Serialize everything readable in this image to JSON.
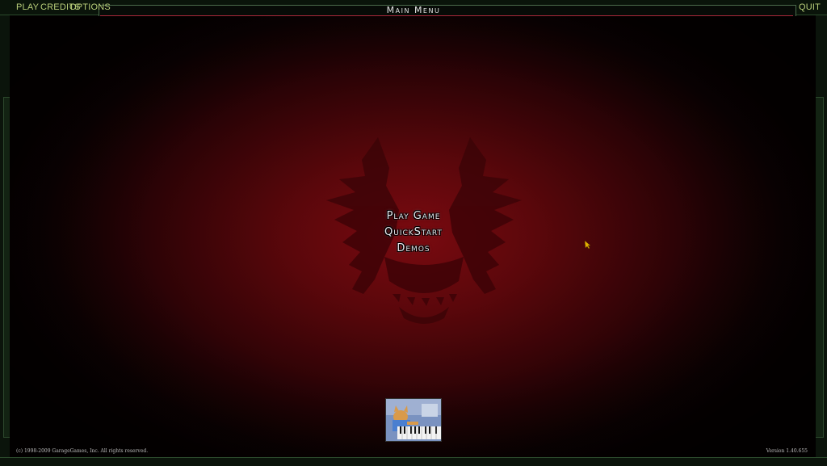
{
  "topbar": {
    "play_label": "PLAY",
    "credits_label": "CREDITS",
    "options_label": "OPTIONS",
    "quit_label": "QUIT",
    "title": "Main Menu"
  },
  "menu": {
    "items": [
      "Play Game",
      "QuickStart",
      "Demos"
    ]
  },
  "footer": {
    "copyright": "(c) 1998-2009 GarageGames, Inc.  All rights reserved.",
    "version": "Version 1.40.655"
  },
  "colors": {
    "accent_green": "#b9cf7a",
    "frame_green": "#2e4a2e",
    "title_underline": "#a8283a",
    "background_red": "#7a0a10"
  },
  "icons": {
    "cursor": "arrow-cursor-icon",
    "emblem": "winged-emblem-icon"
  }
}
